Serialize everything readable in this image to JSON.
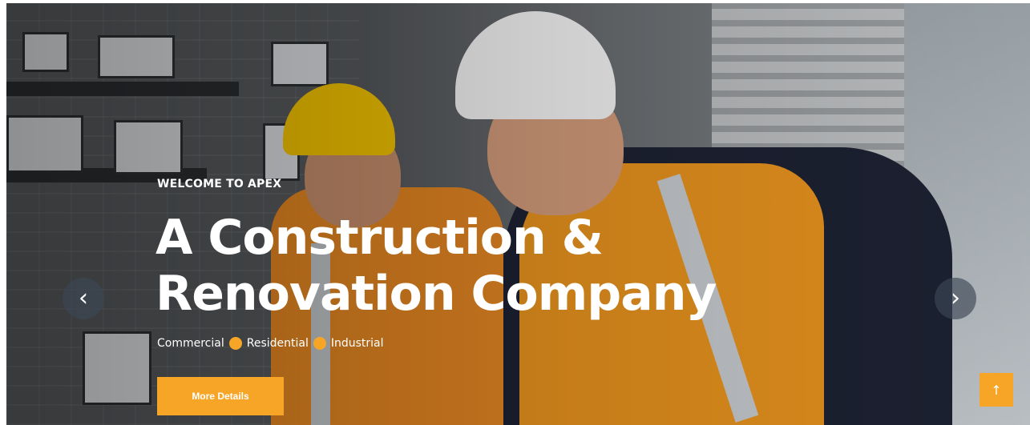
{
  "hero": {
    "eyebrow": "WELCOME TO APEX",
    "headline": "A Construction & Renovation Company",
    "tagline": {
      "items": [
        "Commercial",
        "Residential",
        "Industrial"
      ]
    },
    "cta_label": "More Details"
  },
  "slider": {
    "prev_icon": "chevron-left-icon",
    "prev_glyph": "‹",
    "next_icon": "chevron-right-icon",
    "next_glyph": "›"
  },
  "back_to_top": {
    "icon": "arrow-up-icon",
    "glyph": "↑"
  },
  "colors": {
    "accent": "#f7a527",
    "text": "#ffffff"
  }
}
